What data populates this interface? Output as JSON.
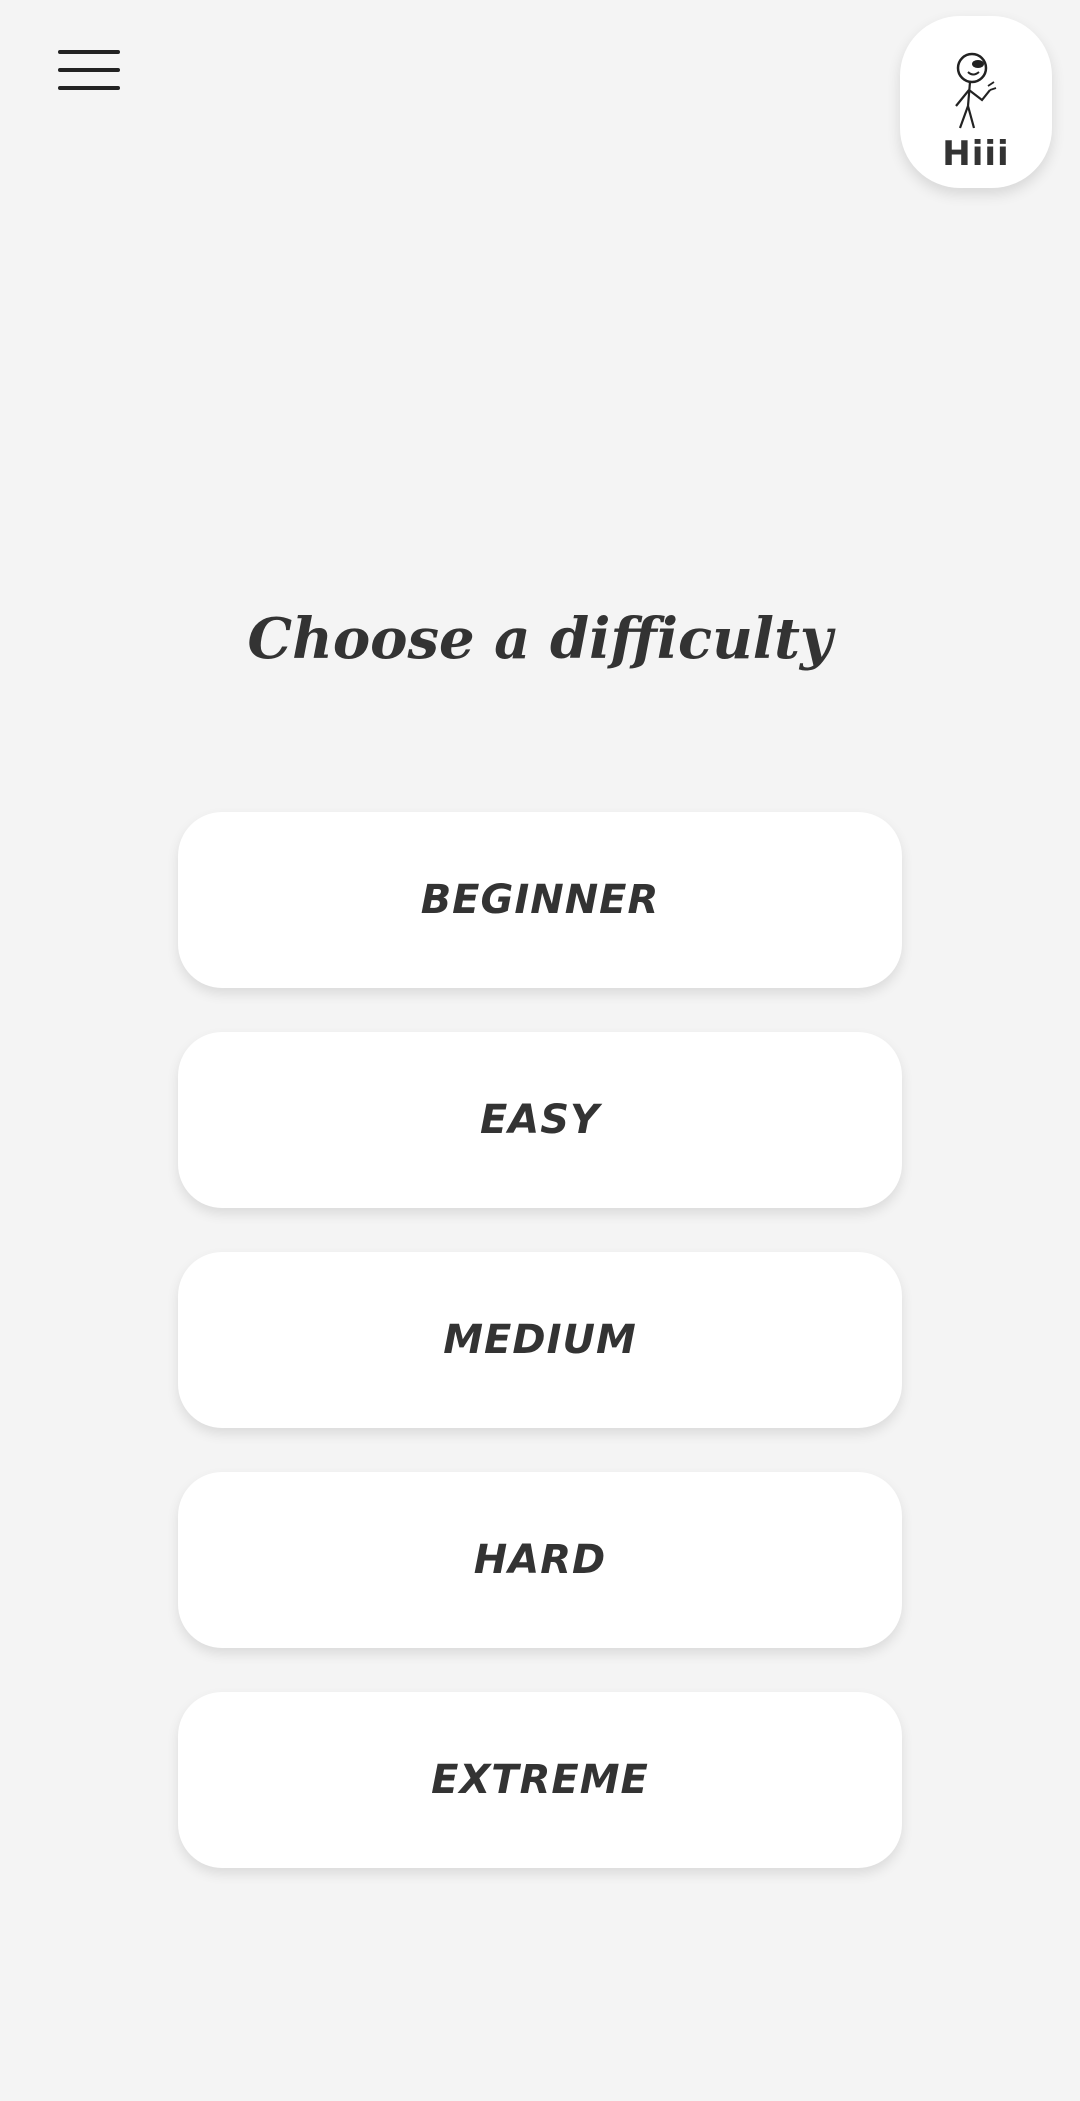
{
  "header": {
    "menu_icon": "hamburger-menu-icon",
    "avatar": {
      "icon": "stick-figure-icon",
      "label": "Hiii"
    }
  },
  "main": {
    "title": "Choose a difficulty",
    "options": [
      {
        "label": "BEGINNER"
      },
      {
        "label": "EASY"
      },
      {
        "label": "MEDIUM"
      },
      {
        "label": "HARD"
      },
      {
        "label": "EXTREME"
      }
    ]
  },
  "colors": {
    "background": "#f4f4f4",
    "card": "#ffffff",
    "text": "#333333"
  }
}
